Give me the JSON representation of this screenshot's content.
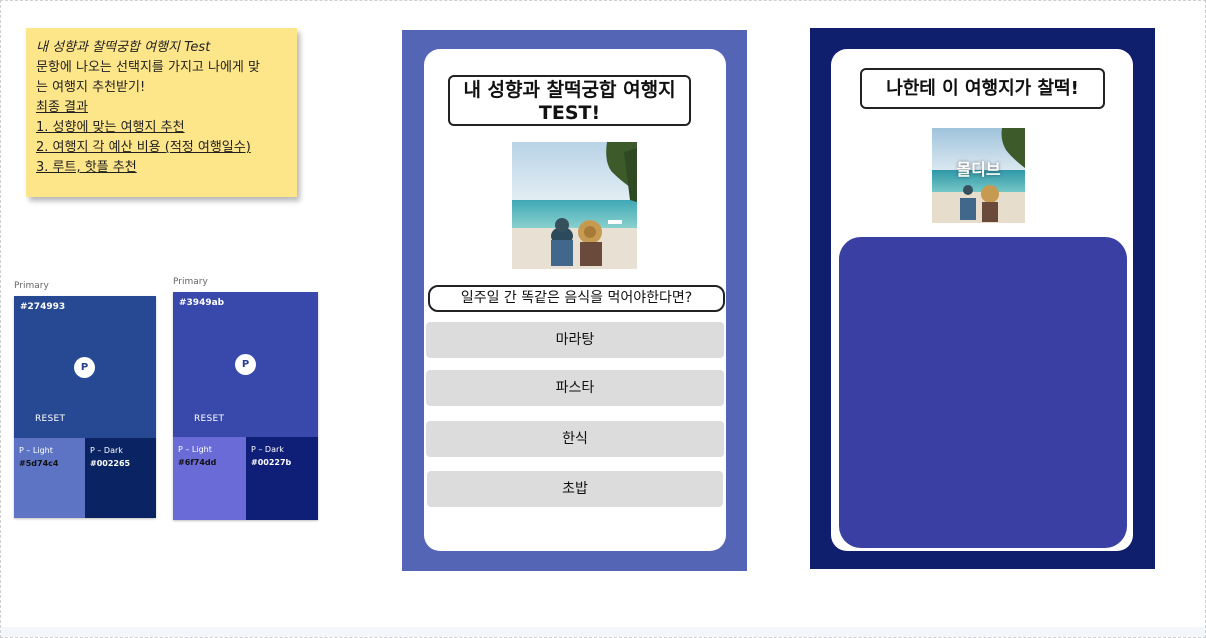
{
  "note": {
    "line1": "내 성향과 찰떡궁합 여행지 Test",
    "line2": "문항에 나오는 선택지를 가지고 나에게 맞",
    "line3": "는 여행지 추천받기!",
    "line4": "최종 결과",
    "line5": "1. 성향에 맞는 여행지 추천",
    "line6": "2. 여행지 각 예산 비용 (적정 여행일수)",
    "line7": "3. 루트, 핫플 추천"
  },
  "palettes": [
    {
      "label": "Primary",
      "primary_hex": "#274993",
      "badge": "P",
      "reset": "RESET",
      "light_label": "P – Light",
      "light_hex": "#5d74c4",
      "dark_label": "P – Dark",
      "dark_hex": "#002265"
    },
    {
      "label": "Primary",
      "primary_hex": "#3949ab",
      "badge": "P",
      "reset": "RESET",
      "light_label": "P – Light",
      "light_hex": "#6f74dd",
      "dark_label": "P – Dark",
      "dark_hex": "#00227b"
    }
  ],
  "quiz": {
    "title_line1": "내 성향과 찰떡궁합 여행지",
    "title_line2": "TEST!",
    "question": "일주일 간 똑같은 음식을 먹어야한다면?",
    "options": [
      "마라탕",
      "파스타",
      "한식",
      "초밥"
    ]
  },
  "result": {
    "title": "나한테 이 여행지가 찰떡!",
    "place": "몰디브"
  },
  "colors": {
    "phone1_bg": "#5565b6",
    "phone2_bg": "#101e6e",
    "result_panel": "#3a3fa4",
    "note_bg": "#fde68a",
    "option_bg": "#dcdcdc"
  },
  "icons": [
    "beach-couple-photo",
    "palm-tree-icon",
    "beach-couple-photo-small"
  ]
}
